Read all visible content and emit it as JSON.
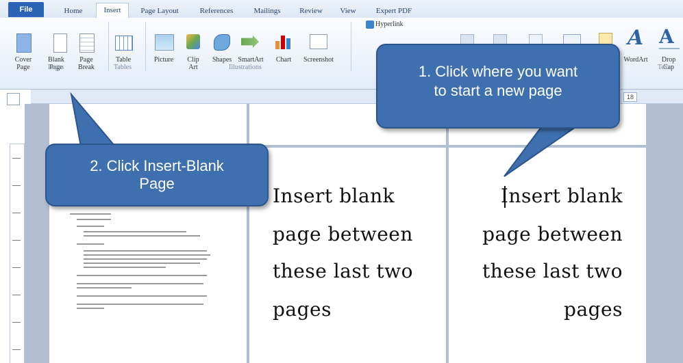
{
  "tabs": [
    "File",
    "Home",
    "Insert",
    "Page Layout",
    "References",
    "Mailings",
    "Review",
    "View",
    "Expert PDF"
  ],
  "ribbon": {
    "cover_page": [
      "Cover",
      "Page"
    ],
    "blank_page": [
      "Blank",
      "Page"
    ],
    "page_break": [
      "Page",
      "Break"
    ],
    "table": "Table",
    "picture": "Picture",
    "clip_art": [
      "Clip",
      "Art"
    ],
    "shapes": "Shapes",
    "smartart": "SmartArt",
    "chart": "Chart",
    "screenshot": "Screenshot",
    "hyperlink": "Hyperlink",
    "wordart": "WordArt",
    "drop_cap": [
      "Drop",
      "Cap"
    ],
    "groups": {
      "pages": "Pages",
      "tables": "Tables",
      "illustrations": "Illustrations",
      "text": "Text"
    }
  },
  "ruler": {
    "number": "18"
  },
  "pages": {
    "middle_text": [
      "Insert blank",
      "page between",
      "these last two",
      "pages"
    ],
    "right_text": [
      "Insert blank",
      "page between",
      "these last two",
      "pages"
    ]
  },
  "callouts": {
    "step1": [
      "1. Click where you want",
      "to start a new page"
    ],
    "step2": [
      "2. Click Insert-Blank",
      "Page"
    ]
  },
  "colors": {
    "callout": "#3e70b0",
    "file_tab": "#2b63b7",
    "ribbon": "#e4ecf7"
  }
}
